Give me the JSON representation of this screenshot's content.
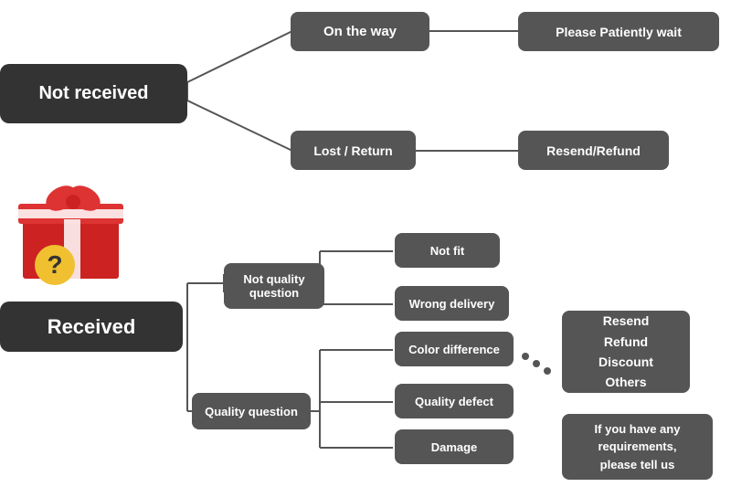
{
  "nodes": {
    "not_received": {
      "label": "Not received"
    },
    "on_the_way": {
      "label": "On the way"
    },
    "please_wait": {
      "label": "Please Patiently wait"
    },
    "lost_return": {
      "label": "Lost / Return"
    },
    "resend_refund_top": {
      "label": "Resend/Refund"
    },
    "received": {
      "label": "Received"
    },
    "not_quality_question": {
      "label": "Not quality\nquestion"
    },
    "not_fit": {
      "label": "Not fit"
    },
    "wrong_delivery": {
      "label": "Wrong delivery"
    },
    "quality_question": {
      "label": "Quality question"
    },
    "color_difference": {
      "label": "Color difference"
    },
    "quality_defect": {
      "label": "Quality defect"
    },
    "damage": {
      "label": "Damage"
    },
    "resend_refund_options": {
      "label": "Resend\nRefund\nDiscount\nOthers"
    },
    "if_you_have": {
      "label": "If you have any\nrequirements,\nplease tell us"
    }
  }
}
